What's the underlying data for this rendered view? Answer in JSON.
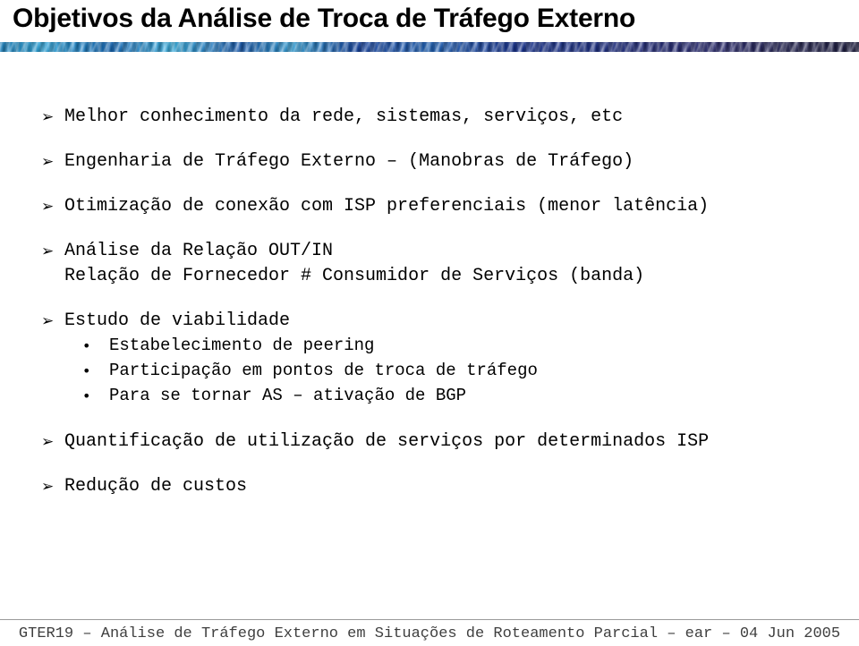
{
  "slide": {
    "title": "Objetivos da Análise de Troca de Tráfego Externo",
    "banner": {
      "name": "title-decorative-band",
      "color_left": "#2aa6dd",
      "color_mid": "#1557ad",
      "color_right": "#1b1b3e"
    },
    "markers": {
      "arrow": "➢",
      "dot": "•"
    },
    "bullets": [
      {
        "level": 1,
        "marker": "arrow",
        "text": "Melhor conhecimento da rede, sistemas, serviços, etc"
      },
      {
        "level": 1,
        "marker": "arrow",
        "text": "Engenharia de Tráfego Externo – (Manobras de Tráfego)"
      },
      {
        "level": 1,
        "marker": "arrow",
        "text": "Otimização de conexão com ISP preferenciais (menor latência)"
      },
      {
        "level": 1,
        "marker": "arrow",
        "text": "Análise da Relação OUT/IN",
        "continuation": "Relação de Fornecedor # Consumidor de Serviços (banda)"
      },
      {
        "level": 1,
        "marker": "arrow",
        "text": "Estudo de viabilidade"
      },
      {
        "level": 2,
        "marker": "dot",
        "text": "Estabelecimento de peering"
      },
      {
        "level": 2,
        "marker": "dot",
        "text": "Participação em pontos de troca de tráfego"
      },
      {
        "level": 2,
        "marker": "dot",
        "text": "Para se tornar AS – ativação de BGP"
      },
      {
        "level": 1,
        "marker": "arrow",
        "text": "Quantificação de utilização de serviços por determinados ISP"
      },
      {
        "level": 1,
        "marker": "arrow",
        "text": "Redução de custos"
      }
    ],
    "footer": {
      "text": "GTER19 – Análise de Tráfego Externo em Situações de Roteamento Parcial – ear – 04 Jun 2005"
    }
  }
}
